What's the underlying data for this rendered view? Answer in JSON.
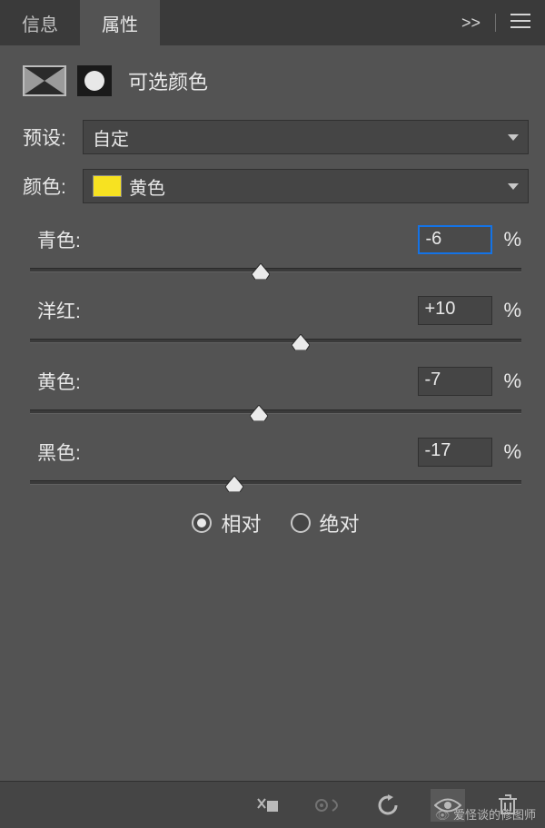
{
  "tabs": {
    "info": "信息",
    "properties": "属性"
  },
  "adjustment": {
    "title": "可选颜色"
  },
  "preset": {
    "label": "预设:",
    "value": "自定"
  },
  "color": {
    "label": "颜色:",
    "value": "黄色",
    "swatch": "#f7e221"
  },
  "sliders": [
    {
      "label": "青色:",
      "value": "-6",
      "thumbPercent": 47,
      "focused": true
    },
    {
      "label": "洋红:",
      "value": "+10",
      "thumbPercent": 55,
      "focused": false
    },
    {
      "label": "黄色:",
      "value": "-7",
      "thumbPercent": 46.5,
      "focused": false
    },
    {
      "label": "黑色:",
      "value": "-17",
      "thumbPercent": 41.5,
      "focused": false
    }
  ],
  "percentSymbol": "%",
  "method": {
    "relative": "相对",
    "absolute": "绝对",
    "selected": "relative"
  },
  "watermark": "爱怪谈的修图师"
}
